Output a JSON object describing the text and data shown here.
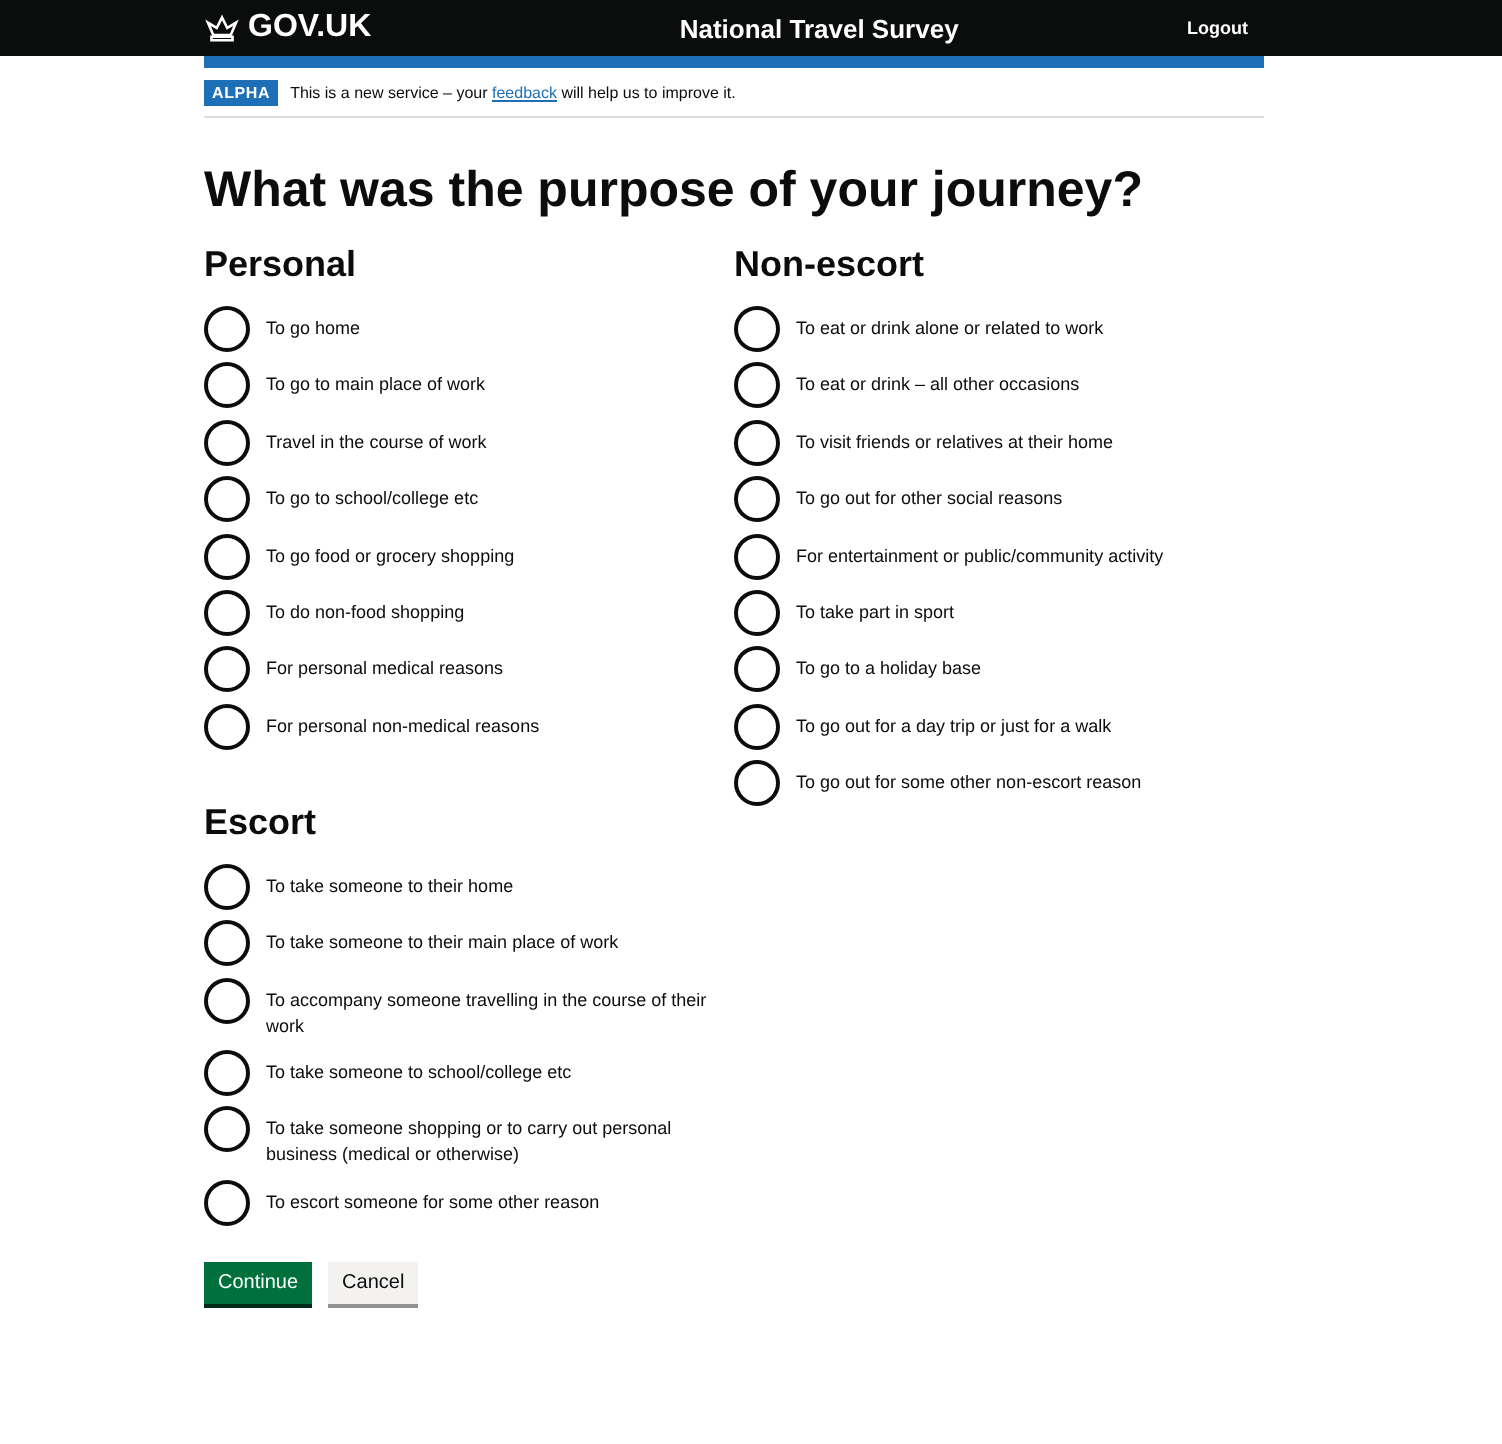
{
  "header": {
    "logo": "GOV.UK",
    "service": "National Travel Survey",
    "logout": "Logout"
  },
  "banner": {
    "tag": "ALPHA",
    "text_before": "This is a new service – your",
    "link": "feedback",
    "text_after": "will help us to improve it."
  },
  "question": "What was the purpose of your journey?",
  "groups": [
    {
      "heading": "Personal",
      "options": [
        {
          "label": "To go home",
          "selected": false
        },
        {
          "label": "To go to main place of work",
          "selected": false
        },
        {
          "label": "Travel in the course of work",
          "selected": false
        },
        {
          "label": "To go to school/college etc",
          "selected": false
        },
        {
          "label": "To go food or grocery shopping",
          "selected": false
        },
        {
          "label": "To do non-food shopping",
          "selected": false
        },
        {
          "label": "For personal medical reasons",
          "selected": false
        },
        {
          "label": "For personal non-medical reasons",
          "selected": false
        }
      ]
    },
    {
      "heading": "Non-escort",
      "options": [
        {
          "label": "To eat or drink alone or related to work",
          "selected": false
        },
        {
          "label": "To eat or drink – all other occasions",
          "selected": false
        },
        {
          "label": "To visit friends or relatives at their home",
          "selected": false
        },
        {
          "label": "To go out for other social reasons",
          "selected": false
        },
        {
          "label": "For entertainment or public/community activity",
          "selected": false
        },
        {
          "label": "To take part in sport",
          "selected": false
        },
        {
          "label": "To go to a holiday base",
          "selected": false
        },
        {
          "label": "To go out for a day trip or just for a walk",
          "selected": false
        },
        {
          "label": "To go out for some other non-escort reason",
          "selected": false
        }
      ]
    },
    {
      "heading": "Escort",
      "options": [
        {
          "label": "To take someone to their home",
          "selected": false
        },
        {
          "label": "To take someone to their main place of work",
          "selected": false
        },
        {
          "label": "To accompany someone travelling in the course of their work",
          "selected": false
        },
        {
          "label": "To take someone to school/college etc",
          "selected": false
        },
        {
          "label": "To take someone shopping or to carry out personal business (medical or otherwise)",
          "selected": false
        },
        {
          "label": "To escort someone for some other reason",
          "selected": false
        }
      ]
    }
  ],
  "buttons": [
    {
      "label": "Continue",
      "kind": "primary"
    },
    {
      "label": "Cancel",
      "kind": "secondary"
    }
  ]
}
